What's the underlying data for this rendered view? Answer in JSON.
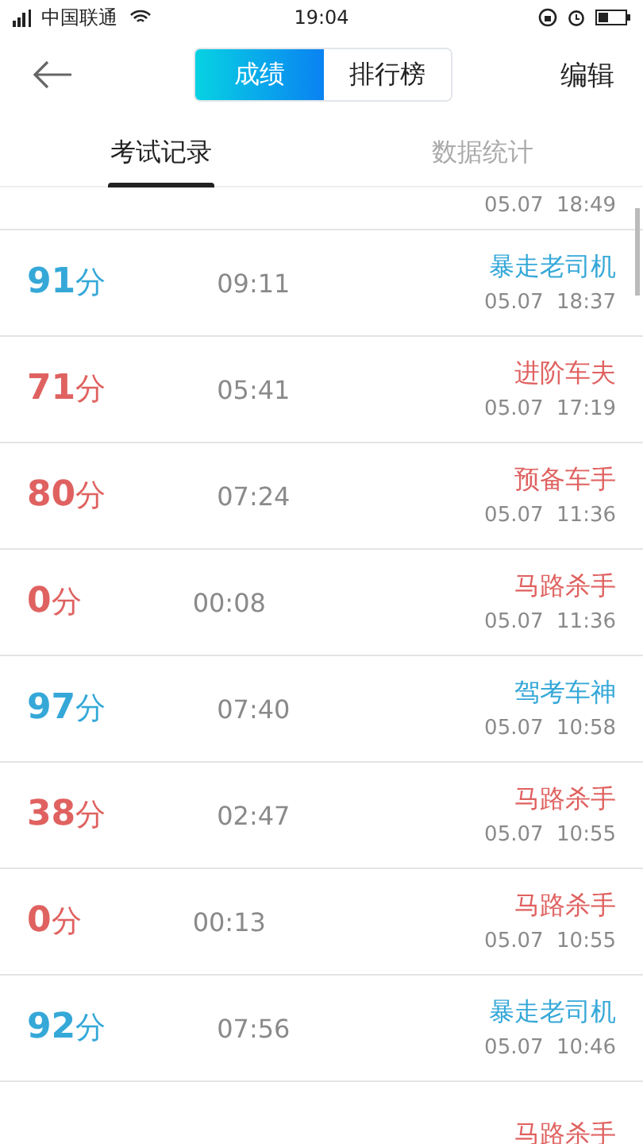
{
  "status_bar": {
    "carrier": "中国联通",
    "time": "19:04"
  },
  "header": {
    "segments": [
      {
        "label": "成绩",
        "selected": true
      },
      {
        "label": "排行榜",
        "selected": false
      }
    ],
    "action": "编辑"
  },
  "tabs": [
    {
      "label": "考试记录",
      "selected": true
    },
    {
      "label": "数据统计",
      "selected": false
    }
  ],
  "records": [
    {
      "date": "05.07  18:49"
    },
    {
      "score": "91",
      "unit": "分",
      "duration": "09:11",
      "title": "暴走老司机",
      "date": "05.07  18:37",
      "color": "#35a8d8"
    },
    {
      "score": "71",
      "unit": "分",
      "duration": "05:41",
      "title": "进阶车夫",
      "date": "05.07  17:19",
      "color": "#df6260"
    },
    {
      "score": "80",
      "unit": "分",
      "duration": "07:24",
      "title": "预备车手",
      "date": "05.07  11:36",
      "color": "#df6260"
    },
    {
      "score": "0",
      "unit": "分",
      "duration": "00:08",
      "title": "马路杀手",
      "date": "05.07  11:36",
      "color": "#df6260"
    },
    {
      "score": "97",
      "unit": "分",
      "duration": "07:40",
      "title": "驾考车神",
      "date": "05.07  10:58",
      "color": "#35a8d8"
    },
    {
      "score": "38",
      "unit": "分",
      "duration": "02:47",
      "title": "马路杀手",
      "date": "05.07  10:55",
      "color": "#df6260"
    },
    {
      "score": "0",
      "unit": "分",
      "duration": "00:13",
      "title": "马路杀手",
      "date": "05.07  10:55",
      "color": "#df6260"
    },
    {
      "score": "92",
      "unit": "分",
      "duration": "07:56",
      "title": "暴走老司机",
      "date": "05.07  10:46",
      "color": "#35a8d8"
    },
    {
      "title": "马路杀手",
      "color": "#df6260"
    }
  ]
}
